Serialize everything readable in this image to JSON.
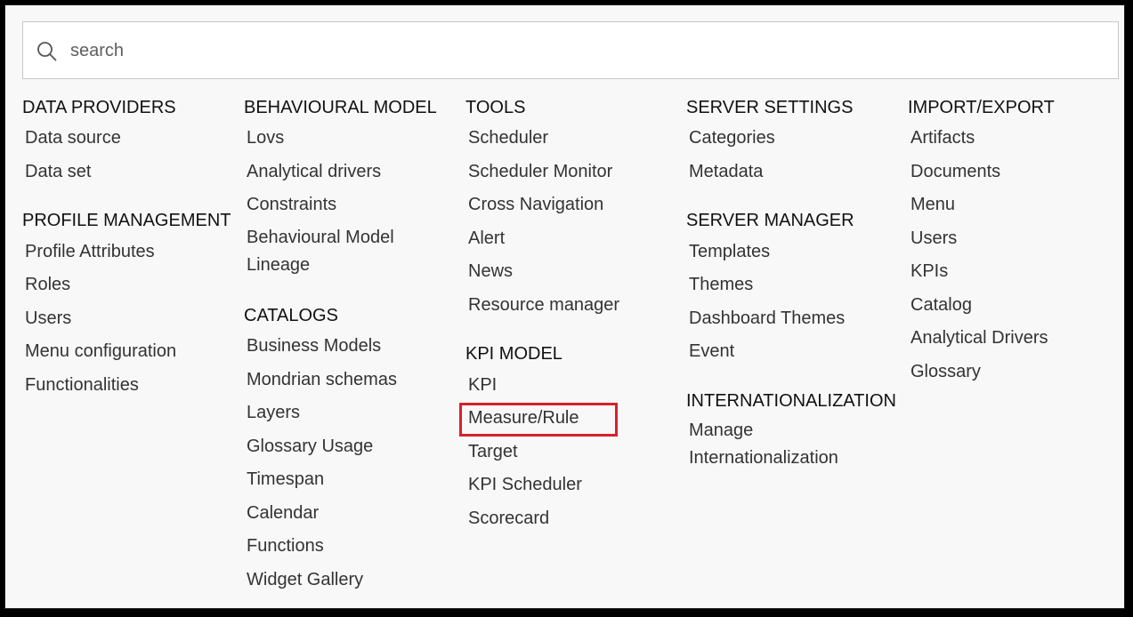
{
  "search": {
    "placeholder": "search",
    "value": ""
  },
  "colors": {
    "background": "#f8f8f8",
    "highlight": "#d9202a",
    "section_text": "#111111",
    "item_text": "#333333"
  },
  "columns": [
    {
      "sections": [
        {
          "title": "DATA PROVIDERS",
          "items": [
            "Data source",
            "Data set"
          ]
        },
        {
          "title": "PROFILE MANAGEMENT",
          "items": [
            "Profile Attributes",
            "Roles",
            "Users",
            "Menu configuration",
            "Functionalities"
          ]
        }
      ]
    },
    {
      "sections": [
        {
          "title": "BEHAVIOURAL MODEL",
          "items": [
            "Lovs",
            "Analytical drivers",
            "Constraints",
            "Behavioural Model Lineage"
          ]
        },
        {
          "title": "CATALOGS",
          "items": [
            "Business Models",
            "Mondrian schemas",
            "Layers",
            "Glossary Usage",
            "Timespan",
            "Calendar",
            "Functions",
            "Widget Gallery"
          ]
        }
      ]
    },
    {
      "sections": [
        {
          "title": "TOOLS",
          "items": [
            "Scheduler",
            "Scheduler Monitor",
            "Cross Navigation",
            "Alert",
            "News",
            "Resource manager"
          ]
        },
        {
          "title": "KPI MODEL",
          "items": [
            "KPI",
            "Measure/Rule",
            "Target",
            "KPI Scheduler",
            "Scorecard"
          ]
        }
      ]
    },
    {
      "sections": [
        {
          "title": "SERVER SETTINGS",
          "items": [
            "Categories",
            "Metadata"
          ]
        },
        {
          "title": "SERVER MANAGER",
          "items": [
            "Templates",
            "Themes",
            "Dashboard Themes",
            "Event"
          ]
        },
        {
          "title": "INTERNATIONALIZATION",
          "items": [
            "Manage Internationalization"
          ]
        }
      ]
    },
    {
      "sections": [
        {
          "title": "IMPORT/EXPORT",
          "items": [
            "Artifacts",
            "Documents",
            "Menu",
            "Users",
            "KPIs",
            "Catalog",
            "Analytical Drivers",
            "Glossary"
          ]
        }
      ]
    }
  ]
}
